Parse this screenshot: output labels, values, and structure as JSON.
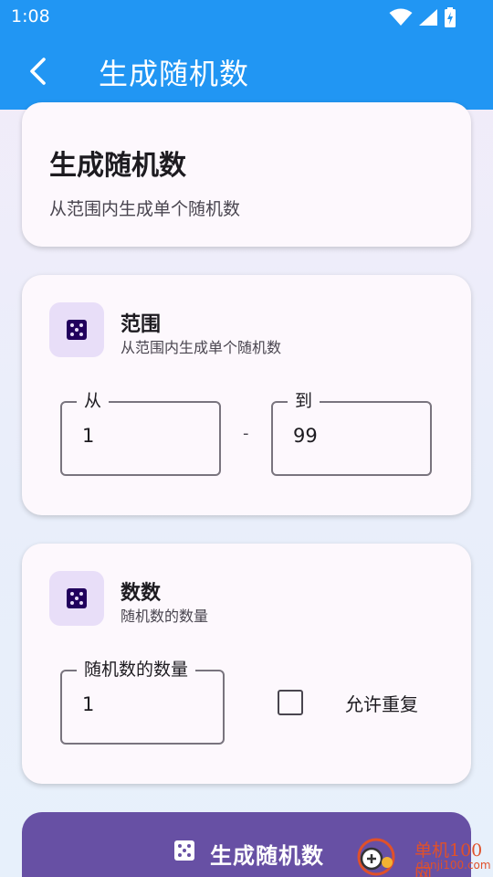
{
  "status_bar": {
    "time": "1:08"
  },
  "app_bar": {
    "title": "生成随机数",
    "back_icon": "arrow-back-icon"
  },
  "header_card": {
    "title": "生成随机数",
    "subtitle": "从范围内生成单个随机数"
  },
  "range_card": {
    "icon": "dice-icon",
    "title": "范围",
    "subtitle": "从范围内生成单个随机数",
    "from": {
      "label": "从",
      "value": "1"
    },
    "separator": "-",
    "to": {
      "label": "到",
      "value": "99"
    }
  },
  "count_card": {
    "icon": "dice-icon",
    "title": "数数",
    "subtitle": "随机数的数量",
    "count": {
      "label": "随机数的数量",
      "value": "1"
    },
    "allow_repeat": {
      "label": "允许重复",
      "checked": false
    }
  },
  "generate_button": {
    "label": "生成随机数",
    "icon": "dice-icon"
  },
  "watermark": {
    "name": "单机100网",
    "domain": "danji100.com"
  },
  "colors": {
    "primary": "#2196f3",
    "accent": "#6750a4",
    "icon_bg": "#e8def8",
    "watermark": "#e0512a"
  }
}
